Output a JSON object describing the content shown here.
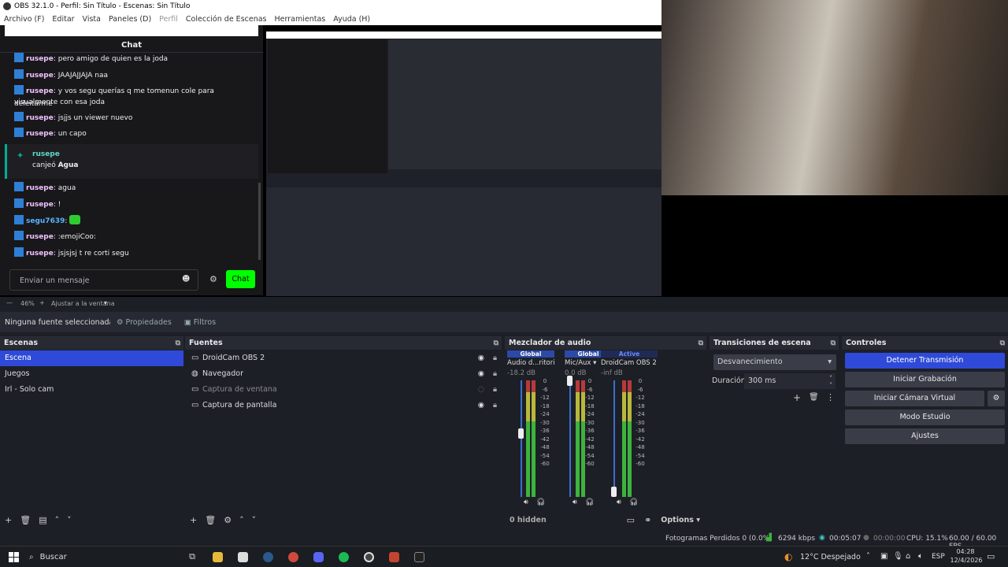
{
  "window": {
    "title": "OBS 32.1.0 - Perfil: Sin Título - Escenas: Sin Título"
  },
  "menu": [
    "Archivo (F)",
    "Editar",
    "Vista",
    "Paneles (D)",
    "Perfil",
    "Colección de Escenas",
    "Herramientas",
    "Ayuda (H)"
  ],
  "chat": {
    "title": "Chat",
    "messages": [
      {
        "user": "rusepe",
        "text": "pero amigo de quien es la joda"
      },
      {
        "user": "rusepe",
        "text": "JAAJAJJAJA naa"
      },
      {
        "user": "rusepe",
        "text": "y vos segu querías q me tomenun cole para deleitarme"
      },
      {
        "user": "",
        "text": "visualmente con esa joda"
      },
      {
        "user": "rusepe",
        "text": "jsjjs un viewer nuevo"
      },
      {
        "user": "rusepe",
        "text": "un capo"
      },
      {
        "user": "rusepe",
        "text": "agua"
      },
      {
        "user": "rusepe",
        "text": "!"
      },
      {
        "user": "segu7639",
        "text": ""
      },
      {
        "user": "rusepe",
        "text": ":emojiCoo:"
      },
      {
        "user": "rusepe",
        "text": "jsjsjsj t re corti segu"
      }
    ],
    "redeem": {
      "user": "rusepe",
      "text": "canjeó",
      "reward": "Agua"
    },
    "input_placeholder": "Enviar un mensaje",
    "send_label": "Chat"
  },
  "zoom": {
    "percent": "46%",
    "fit_label": "Ajustar a la ventana"
  },
  "propbar": {
    "no_source": "Ninguna fuente seleccionada",
    "properties": "Propiedades",
    "filters": "Filtros"
  },
  "scenes": {
    "title": "Escenas",
    "items": [
      {
        "label": "Escena",
        "selected": true
      },
      {
        "label": "Juegos"
      },
      {
        "label": "Irl - Solo cam"
      }
    ]
  },
  "sources": {
    "title": "Fuentes",
    "items": [
      {
        "label": "DroidCam OBS 2",
        "icon": "camera-icon",
        "visible": true
      },
      {
        "label": "Navegador",
        "icon": "globe-icon",
        "visible": true
      },
      {
        "label": "Captura de ventana",
        "icon": "window-icon",
        "visible": false
      },
      {
        "label": "Captura de pantalla",
        "icon": "monitor-icon",
        "visible": true
      }
    ]
  },
  "mixer": {
    "title": "Mezclador de audio",
    "channels": [
      {
        "scope": "Global",
        "name": "Audio d...ritorio",
        "db": "-18.2 dB",
        "level": 0.55
      },
      {
        "scope": "Global",
        "name": "Mic/Aux",
        "db": "0.0 dB",
        "level": 1.0
      },
      {
        "scope": "Active",
        "name": "DroidCam OBS 2",
        "db": "-inf dB",
        "level": 0.05
      }
    ],
    "scale": [
      "0",
      "-6",
      "-12",
      "-18",
      "-24",
      "-30",
      "-36",
      "-42",
      "-48",
      "-54",
      "-60"
    ],
    "hidden": "0 hidden",
    "options": "Options"
  },
  "transitions": {
    "title": "Transiciones de escena",
    "selected": "Desvanecimiento",
    "duration_label": "Duración",
    "duration": "300 ms"
  },
  "controls": {
    "title": "Controles",
    "buttons": [
      "Detener Transmisión",
      "Iniciar Grabación",
      "Iniciar Cámara Virtual",
      "Modo Estudio",
      "Ajustes"
    ]
  },
  "status": {
    "dropped": "Fotogramas Perdidos 0 (0.0%)",
    "bitrate": "6294 kbps",
    "stream_time": "00:05:07",
    "rec_time": "00:00:00",
    "cpu": "CPU: 15.1%",
    "fps": "60.00 / 60.00 FPS"
  },
  "taskbar": {
    "search": "Buscar",
    "weather": "12°C  Despejado",
    "lang": "ESP",
    "time": "04:28",
    "date": "12/4/2026"
  }
}
